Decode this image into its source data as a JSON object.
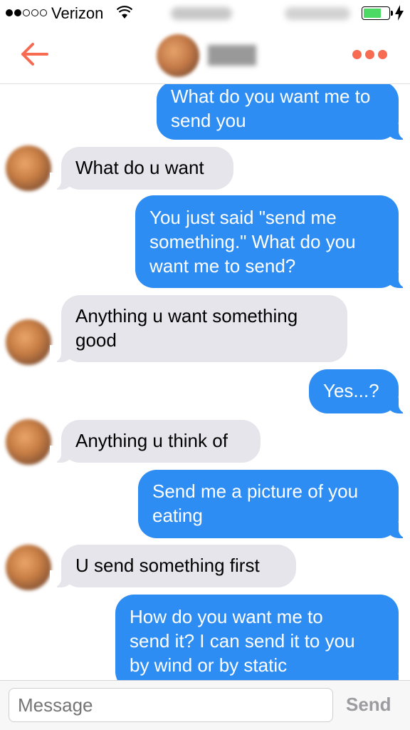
{
  "status_bar": {
    "carrier": "Verizon",
    "signal_bars_filled": 2,
    "signal_bars_total": 5,
    "battery_level": 0.7,
    "battery_color": "#4cd964"
  },
  "header": {
    "back_icon": "back-arrow-icon",
    "more_icon": "more-dots-icon",
    "accent_color": "#f76b52"
  },
  "messages": [
    {
      "side": "sent",
      "text": "What do you want me to\nsend you"
    },
    {
      "side": "received",
      "text": "What do u want"
    },
    {
      "side": "sent",
      "text": "You just said \"send me\nsomething.\" What do you\nwant me to send?"
    },
    {
      "side": "received",
      "text": "Anything  u want something\ngood"
    },
    {
      "side": "sent",
      "text": "Yes...?"
    },
    {
      "side": "received",
      "text": "Anything u think of"
    },
    {
      "side": "sent",
      "text": "Send me a picture of you\neating"
    },
    {
      "side": "received",
      "text": "U send something first"
    },
    {
      "side": "sent",
      "text": "How do you want me to\nsend it? I can send it to you\nby wind or by static"
    }
  ],
  "input": {
    "placeholder": "Message",
    "send_label": "Send"
  },
  "colors": {
    "sent_bubble": "#2d8df3",
    "received_bubble": "#e6e5eb"
  }
}
